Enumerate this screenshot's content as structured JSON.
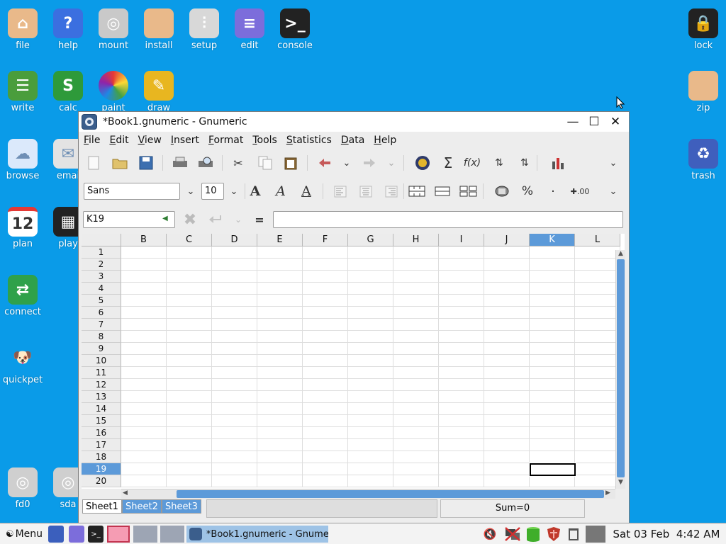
{
  "desktop": {
    "left_icons": [
      {
        "label": "file",
        "icon": "home-folder-icon",
        "color": "#e9b98a"
      },
      {
        "label": "help",
        "icon": "help-icon",
        "color": "#3b6fe0"
      },
      {
        "label": "mount",
        "icon": "disk-icon",
        "color": "#c9c9c9"
      },
      {
        "label": "install",
        "icon": "box-icon",
        "color": "#e9b98a"
      },
      {
        "label": "setup",
        "icon": "sliders-icon",
        "color": "#d8d8d8"
      },
      {
        "label": "edit",
        "icon": "notepad-icon",
        "color": "#7c6ddb"
      },
      {
        "label": "console",
        "icon": "terminal-icon",
        "color": "#222222"
      },
      {
        "label": "write",
        "icon": "document-icon",
        "color": "#4a9d3c"
      },
      {
        "label": "calc",
        "icon": "spreadsheet-icon",
        "color": "#2e9a3a"
      },
      {
        "label": "paint",
        "icon": "palette-icon",
        "color": "#d93b8a"
      },
      {
        "label": "draw",
        "icon": "draw-icon",
        "color": "#e8b620"
      },
      {
        "label": "browse",
        "icon": "cloud-icon",
        "color": "#dbe9fb"
      },
      {
        "label": "emai",
        "icon": "mail-icon",
        "color": "#e3e3e3"
      },
      {
        "label": "plan",
        "icon": "calendar-icon",
        "color": "#ffffff"
      },
      {
        "label": "play",
        "icon": "clapperboard-icon",
        "color": "#222222"
      },
      {
        "label": "connect",
        "icon": "connect-arrows-icon",
        "color": "#2fa14a"
      },
      {
        "label": "quickpet",
        "icon": "dog-icon",
        "color": "#ffffff"
      },
      {
        "label": "fd0",
        "icon": "floppy-disk-icon",
        "color": "#cfcfcf"
      },
      {
        "label": "sda",
        "icon": "drive-icon",
        "color": "#cfcfcf"
      }
    ],
    "right_icons": [
      {
        "label": "lock",
        "icon": "lock-icon",
        "color": "#222222"
      },
      {
        "label": "zip",
        "icon": "archive-icon",
        "color": "#e9b98a"
      },
      {
        "label": "trash",
        "icon": "recycle-icon",
        "color": "#3f5fbd"
      }
    ],
    "plan_day": "12"
  },
  "window": {
    "title": "*Book1.gnumeric - Gnumeric",
    "menu": [
      "File",
      "Edit",
      "View",
      "Insert",
      "Format",
      "Tools",
      "Statistics",
      "Data",
      "Help"
    ],
    "font_name": "Sans",
    "font_size": "10",
    "cell_ref": "K19",
    "formula_equals": "=",
    "formula_value": "",
    "columns": [
      "B",
      "C",
      "D",
      "E",
      "F",
      "G",
      "H",
      "I",
      "J",
      "K",
      "L"
    ],
    "selected_column": "K",
    "rows": [
      "1",
      "2",
      "3",
      "4",
      "5",
      "6",
      "7",
      "8",
      "9",
      "10",
      "11",
      "12",
      "13",
      "14",
      "15",
      "16",
      "17",
      "18",
      "19",
      "20"
    ],
    "selected_row": "19",
    "sheets": [
      "Sheet1",
      "Sheet2",
      "Sheet3"
    ],
    "active_sheet": "Sheet1",
    "status_sum": "Sum=0",
    "toolbar_format_labels": {
      "percent": "%",
      "decimal": "·",
      "increase_decimal": ".00"
    }
  },
  "taskbar": {
    "menu_label": "Menu",
    "task_label": "*Book1.gnumeric - Gnume",
    "clock_date": "Sat 03 Feb",
    "clock_time": "4:42 AM"
  },
  "colors": {
    "desktop_bg": "#0a9be8",
    "selection": "#5c9ad9",
    "window_bg": "#ededed"
  }
}
